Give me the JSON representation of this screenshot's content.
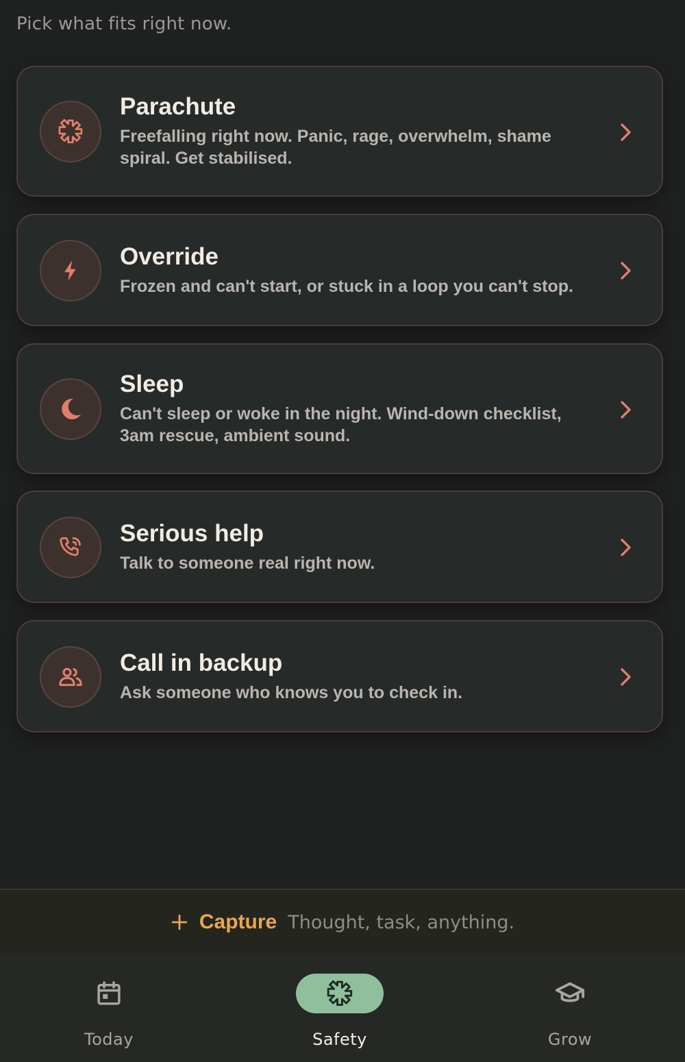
{
  "subtitle": "Pick what fits right now.",
  "accent_color": "#e07e6c",
  "options": [
    {
      "icon": "asterisk-icon",
      "title": "Parachute",
      "description": "Freefalling right now. Panic, rage, overwhelm, shame spiral. Get stabilised."
    },
    {
      "icon": "lightning-icon",
      "title": "Override",
      "description": "Frozen and can't start, or stuck in a loop you can't stop."
    },
    {
      "icon": "moon-icon",
      "title": "Sleep",
      "description": "Can't sleep or woke in the night. Wind-down checklist, 3am rescue, ambient sound."
    },
    {
      "icon": "phone-call-icon",
      "title": "Serious help",
      "description": "Talk to someone real right now."
    },
    {
      "icon": "people-icon",
      "title": "Call in backup",
      "description": "Ask someone who knows you to check in."
    }
  ],
  "capture": {
    "icon": "plus-icon",
    "label": "Capture",
    "hint": "Thought, task, anything.",
    "color": "#e8a553"
  },
  "nav": {
    "items": [
      {
        "label": "Today",
        "icon": "calendar-icon",
        "active": false
      },
      {
        "label": "Safety",
        "icon": "asterisk-icon",
        "active": true
      },
      {
        "label": "Grow",
        "icon": "graduation-cap-icon",
        "active": false
      }
    ],
    "active_color": "#8fbf9c"
  }
}
